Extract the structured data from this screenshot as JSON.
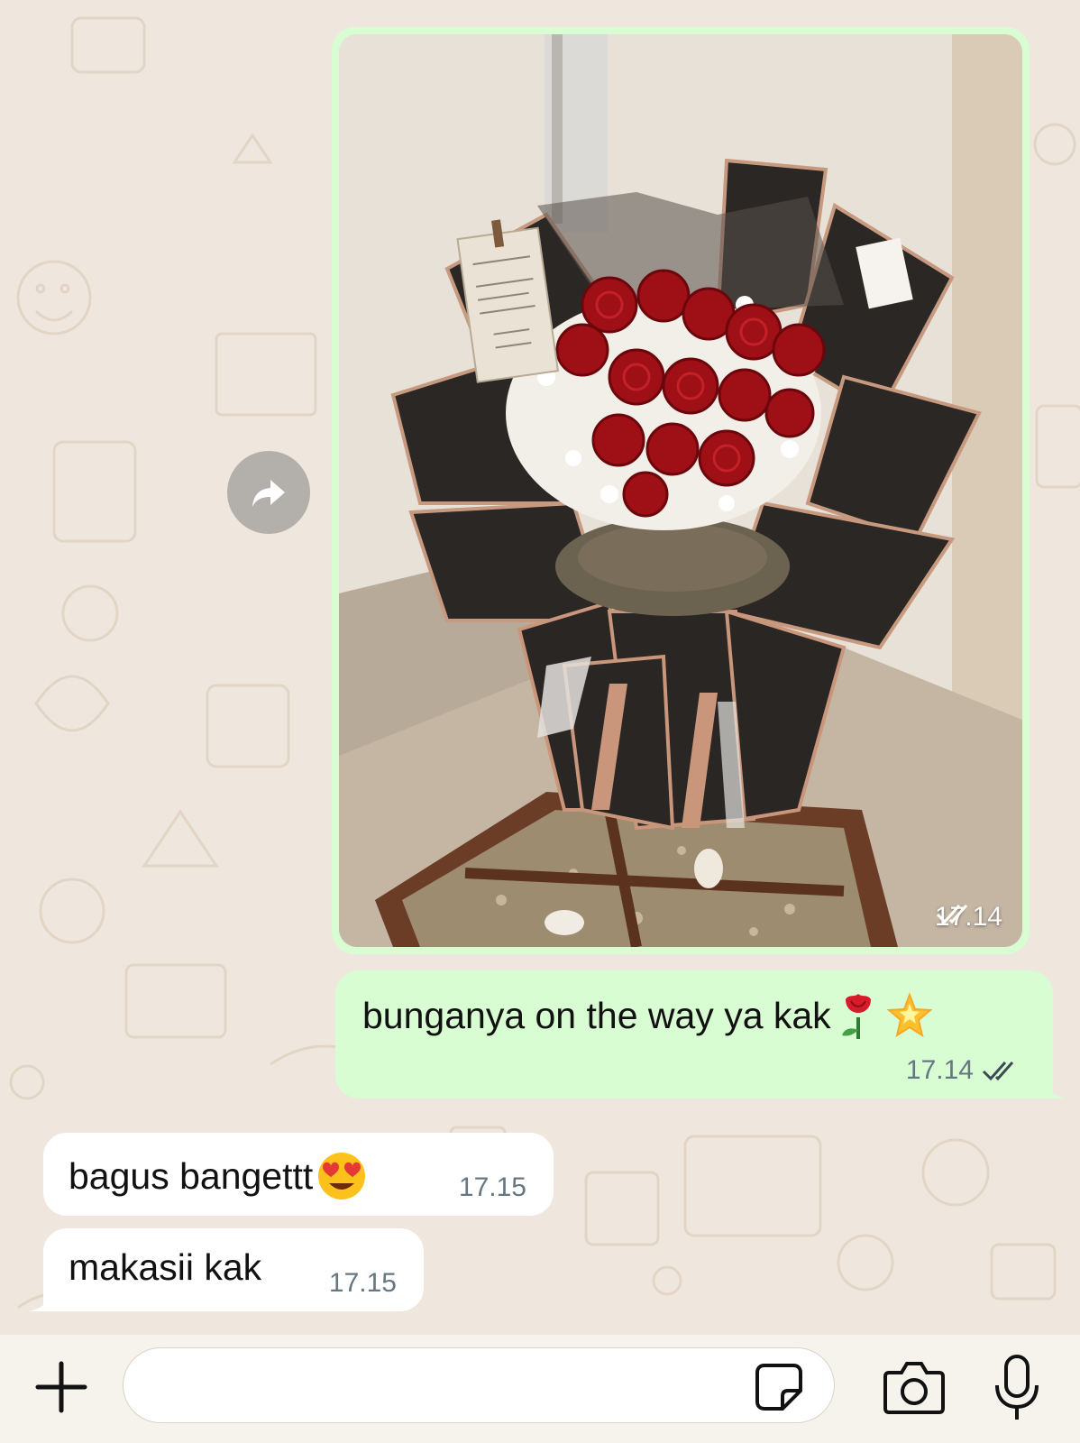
{
  "messages": [
    {
      "type": "image",
      "direction": "outgoing",
      "time": "17.14",
      "status": "read"
    },
    {
      "type": "text",
      "direction": "outgoing",
      "text": "bunganya on the way ya kak",
      "time": "17.14",
      "status": "read"
    },
    {
      "type": "text",
      "direction": "incoming",
      "text": "bagus bangettt",
      "time": "17.15"
    },
    {
      "type": "text",
      "direction": "incoming",
      "text": "makasii kak",
      "time": "17.15"
    }
  ],
  "input": {
    "placeholder": ""
  },
  "colors": {
    "outgoing_bubble": "#d9fdd3",
    "incoming_bubble": "#ffffff",
    "background": "#efe7dd"
  },
  "icons": [
    "forward-icon",
    "double-check-icon",
    "rose-emoji",
    "star-emoji",
    "heart-eyes-emoji",
    "plus-icon",
    "sticker-icon",
    "camera-icon",
    "mic-icon"
  ]
}
